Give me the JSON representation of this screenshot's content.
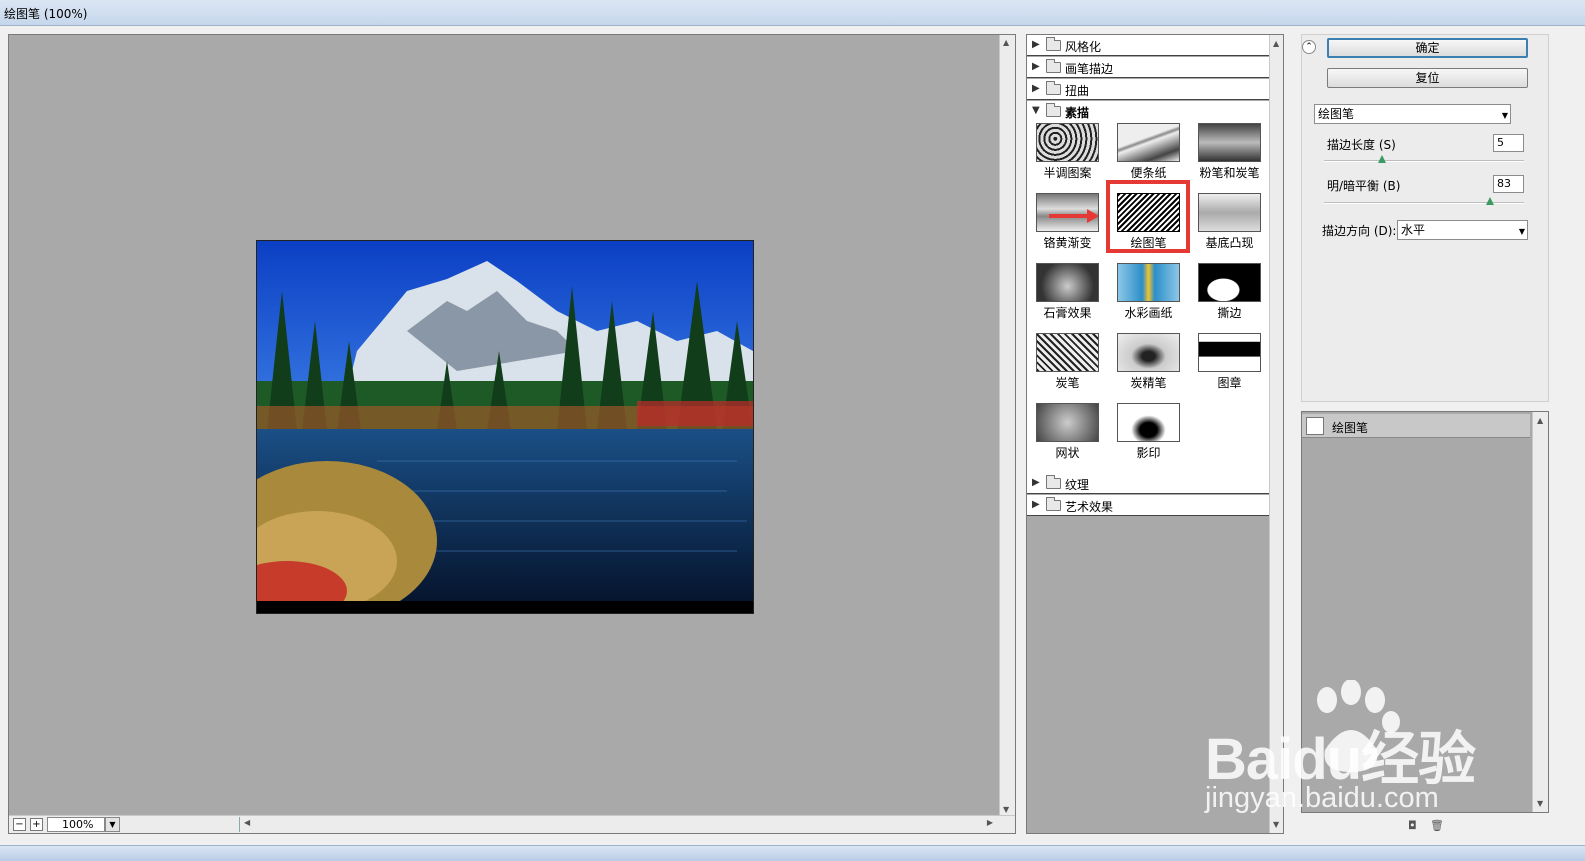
{
  "window": {
    "title": "绘图笔 (100%)"
  },
  "preview": {
    "zoom": "100%",
    "zoom_out": "−",
    "zoom_in": "+"
  },
  "filter_gallery": {
    "categories_top": [
      "风格化",
      "画笔描边",
      "扭曲"
    ],
    "open_category": "素描",
    "thumbnails": [
      "半调图案",
      "便条纸",
      "粉笔和炭笔",
      "铬黄渐变",
      "绘图笔",
      "基底凸现",
      "石膏效果",
      "水彩画纸",
      "撕边",
      "炭笔",
      "炭精笔",
      "图章",
      "网状",
      "影印"
    ],
    "selected": "绘图笔",
    "categories_bottom": [
      "纹理",
      "艺术效果"
    ]
  },
  "settings": {
    "ok_label": "确定",
    "reset_label": "复位",
    "filter_select": "绘图笔",
    "params": [
      {
        "label": "描边长度 (S)",
        "value": "5",
        "fraction": 0.29
      },
      {
        "label": "明/暗平衡 (B)",
        "value": "83",
        "fraction": 0.83
      }
    ],
    "direction_label": "描边方向 (D):",
    "direction_value": "水平"
  },
  "layers": {
    "items": [
      "绘图笔"
    ]
  },
  "watermark": {
    "line1": "Baidu经验",
    "line2": "jingyan.baidu.com"
  },
  "colors": {
    "selection_highlight": "#e53935",
    "canvas_bg": "#a9a9a9",
    "slider_knob": "#3a9b62"
  }
}
